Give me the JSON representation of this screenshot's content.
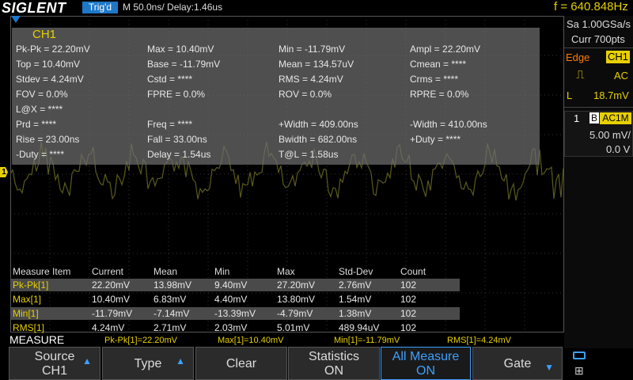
{
  "header": {
    "logo": "SIGLENT",
    "trigger_status": "Trig'd",
    "timebase": "M 50.0ns/ Delay:1.46us",
    "frequency": "f = 640.848Hz"
  },
  "right_panel": {
    "sample_rate": "Sa 1.00GSa/s",
    "memory": "Curr 700pts",
    "trigger_type": "Edge",
    "trigger_source": "CH1",
    "coupling": "AC",
    "level_label": "L",
    "level_value": "18.7mV",
    "channel_num": "1",
    "bw_flag": "B",
    "channel_coupling": "AC1M",
    "volts_div": "5.00 mV/",
    "offset": "0.0 V"
  },
  "measurements": {
    "title": "CH1",
    "rows": [
      [
        "Pk-Pk = 22.20mV",
        "Max = 10.40mV",
        "Min = -11.79mV",
        "Ampl = 22.20mV"
      ],
      [
        "Top = 10.40mV",
        "Base = -11.79mV",
        "Mean = 134.57uV",
        "Cmean = ****"
      ],
      [
        "Stdev = 4.24mV",
        "Cstd = ****",
        "RMS = 4.24mV",
        "Crms = ****"
      ],
      [
        "FOV = 0.0%",
        "FPRE = 0.0%",
        "ROV = 0.0%",
        "RPRE = 0.0%"
      ],
      [
        "L@X = ****",
        "",
        "",
        ""
      ],
      [
        "Prd = ****",
        "Freq = ****",
        "+Width = 409.00ns",
        "-Width = 410.00ns"
      ],
      [
        "Rise = 23.00ns",
        "Fall = 33.00ns",
        "Bwidth = 682.00ns",
        "+Duty = ****"
      ],
      [
        "-Duty = ****",
        "Delay = 1.54us",
        "T@L = 1.58us",
        ""
      ]
    ]
  },
  "statistics": {
    "headers": [
      "Measure Item",
      "Current",
      "Mean",
      "Min",
      "Max",
      "Std-Dev",
      "Count"
    ],
    "rows": [
      [
        "Pk-Pk[1]",
        "22.20mV",
        "13.98mV",
        "9.40mV",
        "27.20mV",
        "2.76mV",
        "102"
      ],
      [
        "Max[1]",
        "10.40mV",
        "6.83mV",
        "4.40mV",
        "13.80mV",
        "1.54mV",
        "102"
      ],
      [
        "Min[1]",
        "-11.79mV",
        "-7.14mV",
        "-13.39mV",
        "-4.79mV",
        "1.38mV",
        "102"
      ],
      [
        "RMS[1]",
        "4.24mV",
        "2.71mV",
        "2.03mV",
        "5.01mV",
        "489.94uV",
        "102"
      ]
    ]
  },
  "bottom_strip": {
    "label": "MEASURE",
    "items": [
      "Pk-Pk[1]=22.20mV",
      "Max[1]=10.40mV",
      "Min[1]=-11.79mV",
      "RMS[1]=4.24mV"
    ]
  },
  "softkeys": [
    {
      "line1": "Source",
      "line2": "CH1",
      "arrow": true
    },
    {
      "line1": "Type",
      "line2": "",
      "arrow": true
    },
    {
      "line1": "Clear",
      "line2": "",
      "arrow": false
    },
    {
      "line1": "Statistics",
      "line2": "ON",
      "arrow": false
    },
    {
      "line1": "All Measure",
      "line2": "ON",
      "arrow": false,
      "active": true
    },
    {
      "line1": "Gate",
      "line2": "",
      "arrow": true
    }
  ],
  "channel_marker": "1",
  "colors": {
    "ch1": "#e8d000",
    "trace": "#5b5a1e",
    "accent": "#1e78c8",
    "panel": "#6e6e6e"
  }
}
